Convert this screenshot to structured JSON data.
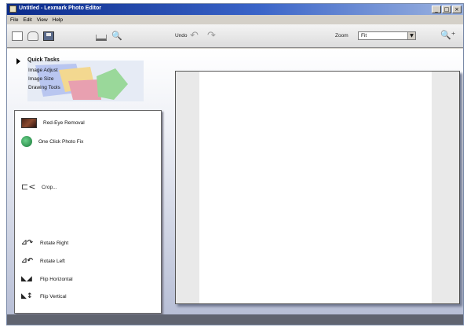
{
  "window": {
    "title": "Untitled - Lexmark Photo Editor",
    "controls": {
      "minimize": "_",
      "maximize": "□",
      "close": "×"
    }
  },
  "menu": [
    "File",
    "Edit",
    "View",
    "Help"
  ],
  "toolbar": {
    "undo_label": "Undo",
    "undo_icon": "↶",
    "redo_icon": "↷",
    "zoom_label": "Zoom",
    "zoom_value": "Fit",
    "dropdown_arrow": "▼",
    "zoom_tool_icon": "🔍",
    "zoom_in_icon": "🔍⁺",
    "icons": [
      "new-document-icon",
      "open-folder-icon",
      "save-icon",
      "scan-icon",
      "zoom-tool-icon",
      "zoom-in-icon"
    ]
  },
  "quick_tasks": {
    "title": "Quick Tasks",
    "items": [
      "Image Adjust",
      "Image Size",
      "Drawing Tools"
    ]
  },
  "tools": [
    {
      "label": "Red-Eye Removal",
      "icon": "red-eye-icon",
      "glyph": ""
    },
    {
      "label": "One Click Photo Fix",
      "icon": "magic-wand-icon",
      "glyph": ""
    },
    {
      "label": "Crop...",
      "icon": "crop-icon",
      "glyph": "⊏<"
    },
    {
      "label": "Rotate Right",
      "icon": "rotate-right-icon",
      "glyph": "⊿↷"
    },
    {
      "label": "Rotate Left",
      "icon": "rotate-left-icon",
      "glyph": "⊿↶"
    },
    {
      "label": "Flip Horizontal",
      "icon": "flip-horizontal-icon",
      "glyph": "◣◢"
    },
    {
      "label": "Flip Vertical",
      "icon": "flip-vertical-icon",
      "glyph": "◣↕"
    }
  ],
  "colors": {
    "title_bar": "#0a2a8a",
    "workspace_gradient_top": "#ffffff",
    "workspace_gradient_bottom": "#b8bfd6",
    "status_bar": "#606470"
  }
}
